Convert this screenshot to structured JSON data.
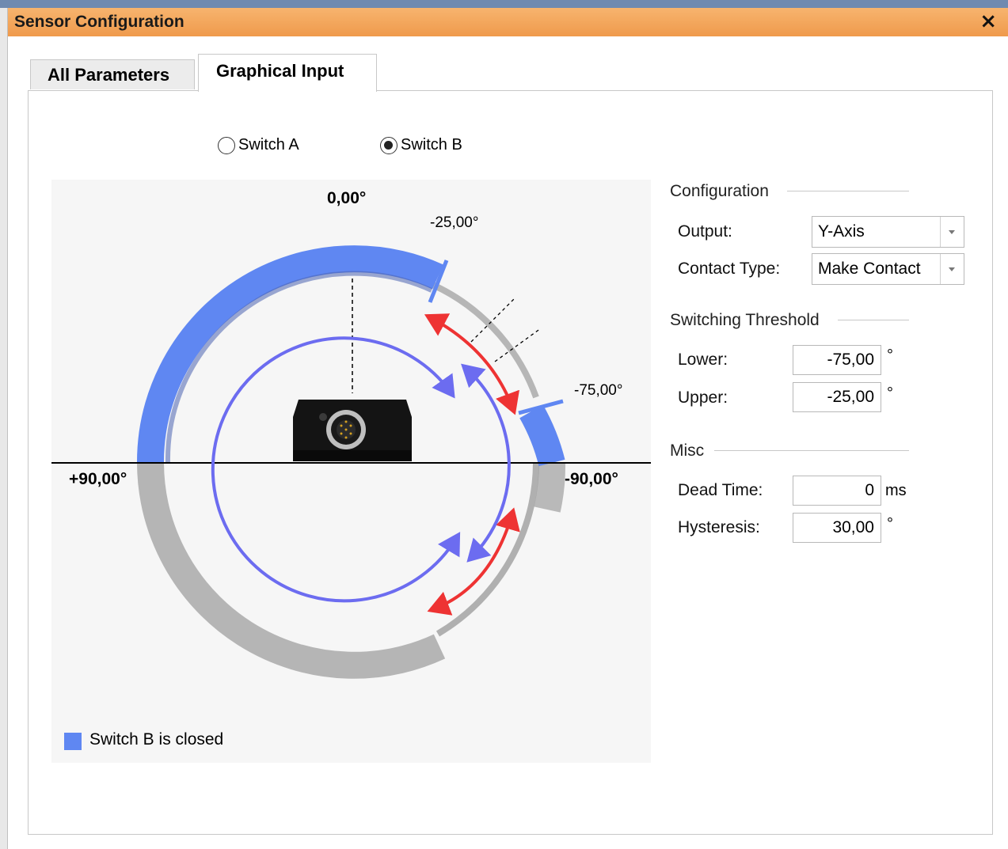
{
  "window": {
    "title": "Sensor Configuration",
    "close_symbol": "×"
  },
  "tabs": [
    {
      "label": "All Parameters",
      "active": false
    },
    {
      "label": "Graphical Input",
      "active": true
    }
  ],
  "switch_selector": {
    "options": [
      {
        "label": "Switch A",
        "selected": false
      },
      {
        "label": "Switch B",
        "selected": true
      }
    ]
  },
  "diagram": {
    "angle_top": "0,00°",
    "angle_left": "+90,00°",
    "angle_right": "-90,00°",
    "marker_upper": "-25,00°",
    "marker_lower": "-75,00°",
    "legend": {
      "label": "Switch B is closed",
      "color": "#5f87f2"
    },
    "colors": {
      "closed_arc": "#5f87f2",
      "open_arc": "#a9a9a9",
      "hysteresis_arrow": "#ee3333",
      "motion_arrow": "#6c6cf0"
    }
  },
  "configuration": {
    "heading": "Configuration",
    "output": {
      "label": "Output:",
      "value": "Y-Axis"
    },
    "contact_type": {
      "label": "Contact Type:",
      "value": "Make Contact"
    }
  },
  "threshold": {
    "heading": "Switching Threshold",
    "lower": {
      "label": "Lower:",
      "value": "-75,00",
      "unit": "°"
    },
    "upper": {
      "label": "Upper:",
      "value": "-25,00",
      "unit": "°"
    }
  },
  "misc": {
    "heading": "Misc",
    "dead_time": {
      "label": "Dead Time:",
      "value": "0",
      "unit": "ms"
    },
    "hysteresis": {
      "label": "Hysteresis:",
      "value": "30,00",
      "unit": "°"
    }
  }
}
